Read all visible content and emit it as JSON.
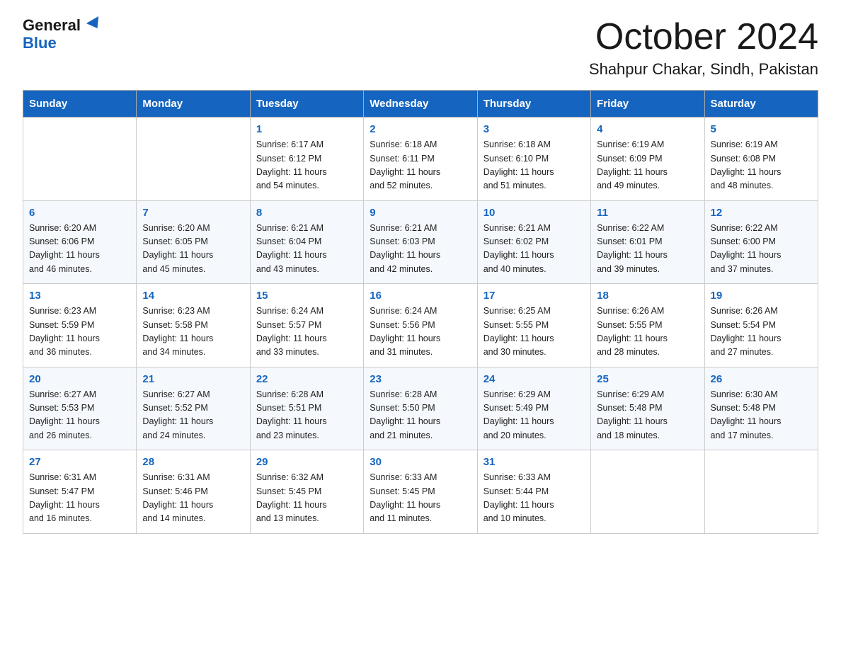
{
  "header": {
    "logo_general": "General",
    "logo_blue": "Blue",
    "month_title": "October 2024",
    "location": "Shahpur Chakar, Sindh, Pakistan"
  },
  "weekdays": [
    "Sunday",
    "Monday",
    "Tuesday",
    "Wednesday",
    "Thursday",
    "Friday",
    "Saturday"
  ],
  "weeks": [
    [
      {
        "day": "",
        "info": ""
      },
      {
        "day": "",
        "info": ""
      },
      {
        "day": "1",
        "info": "Sunrise: 6:17 AM\nSunset: 6:12 PM\nDaylight: 11 hours\nand 54 minutes."
      },
      {
        "day": "2",
        "info": "Sunrise: 6:18 AM\nSunset: 6:11 PM\nDaylight: 11 hours\nand 52 minutes."
      },
      {
        "day": "3",
        "info": "Sunrise: 6:18 AM\nSunset: 6:10 PM\nDaylight: 11 hours\nand 51 minutes."
      },
      {
        "day": "4",
        "info": "Sunrise: 6:19 AM\nSunset: 6:09 PM\nDaylight: 11 hours\nand 49 minutes."
      },
      {
        "day": "5",
        "info": "Sunrise: 6:19 AM\nSunset: 6:08 PM\nDaylight: 11 hours\nand 48 minutes."
      }
    ],
    [
      {
        "day": "6",
        "info": "Sunrise: 6:20 AM\nSunset: 6:06 PM\nDaylight: 11 hours\nand 46 minutes."
      },
      {
        "day": "7",
        "info": "Sunrise: 6:20 AM\nSunset: 6:05 PM\nDaylight: 11 hours\nand 45 minutes."
      },
      {
        "day": "8",
        "info": "Sunrise: 6:21 AM\nSunset: 6:04 PM\nDaylight: 11 hours\nand 43 minutes."
      },
      {
        "day": "9",
        "info": "Sunrise: 6:21 AM\nSunset: 6:03 PM\nDaylight: 11 hours\nand 42 minutes."
      },
      {
        "day": "10",
        "info": "Sunrise: 6:21 AM\nSunset: 6:02 PM\nDaylight: 11 hours\nand 40 minutes."
      },
      {
        "day": "11",
        "info": "Sunrise: 6:22 AM\nSunset: 6:01 PM\nDaylight: 11 hours\nand 39 minutes."
      },
      {
        "day": "12",
        "info": "Sunrise: 6:22 AM\nSunset: 6:00 PM\nDaylight: 11 hours\nand 37 minutes."
      }
    ],
    [
      {
        "day": "13",
        "info": "Sunrise: 6:23 AM\nSunset: 5:59 PM\nDaylight: 11 hours\nand 36 minutes."
      },
      {
        "day": "14",
        "info": "Sunrise: 6:23 AM\nSunset: 5:58 PM\nDaylight: 11 hours\nand 34 minutes."
      },
      {
        "day": "15",
        "info": "Sunrise: 6:24 AM\nSunset: 5:57 PM\nDaylight: 11 hours\nand 33 minutes."
      },
      {
        "day": "16",
        "info": "Sunrise: 6:24 AM\nSunset: 5:56 PM\nDaylight: 11 hours\nand 31 minutes."
      },
      {
        "day": "17",
        "info": "Sunrise: 6:25 AM\nSunset: 5:55 PM\nDaylight: 11 hours\nand 30 minutes."
      },
      {
        "day": "18",
        "info": "Sunrise: 6:26 AM\nSunset: 5:55 PM\nDaylight: 11 hours\nand 28 minutes."
      },
      {
        "day": "19",
        "info": "Sunrise: 6:26 AM\nSunset: 5:54 PM\nDaylight: 11 hours\nand 27 minutes."
      }
    ],
    [
      {
        "day": "20",
        "info": "Sunrise: 6:27 AM\nSunset: 5:53 PM\nDaylight: 11 hours\nand 26 minutes."
      },
      {
        "day": "21",
        "info": "Sunrise: 6:27 AM\nSunset: 5:52 PM\nDaylight: 11 hours\nand 24 minutes."
      },
      {
        "day": "22",
        "info": "Sunrise: 6:28 AM\nSunset: 5:51 PM\nDaylight: 11 hours\nand 23 minutes."
      },
      {
        "day": "23",
        "info": "Sunrise: 6:28 AM\nSunset: 5:50 PM\nDaylight: 11 hours\nand 21 minutes."
      },
      {
        "day": "24",
        "info": "Sunrise: 6:29 AM\nSunset: 5:49 PM\nDaylight: 11 hours\nand 20 minutes."
      },
      {
        "day": "25",
        "info": "Sunrise: 6:29 AM\nSunset: 5:48 PM\nDaylight: 11 hours\nand 18 minutes."
      },
      {
        "day": "26",
        "info": "Sunrise: 6:30 AM\nSunset: 5:48 PM\nDaylight: 11 hours\nand 17 minutes."
      }
    ],
    [
      {
        "day": "27",
        "info": "Sunrise: 6:31 AM\nSunset: 5:47 PM\nDaylight: 11 hours\nand 16 minutes."
      },
      {
        "day": "28",
        "info": "Sunrise: 6:31 AM\nSunset: 5:46 PM\nDaylight: 11 hours\nand 14 minutes."
      },
      {
        "day": "29",
        "info": "Sunrise: 6:32 AM\nSunset: 5:45 PM\nDaylight: 11 hours\nand 13 minutes."
      },
      {
        "day": "30",
        "info": "Sunrise: 6:33 AM\nSunset: 5:45 PM\nDaylight: 11 hours\nand 11 minutes."
      },
      {
        "day": "31",
        "info": "Sunrise: 6:33 AM\nSunset: 5:44 PM\nDaylight: 11 hours\nand 10 minutes."
      },
      {
        "day": "",
        "info": ""
      },
      {
        "day": "",
        "info": ""
      }
    ]
  ]
}
